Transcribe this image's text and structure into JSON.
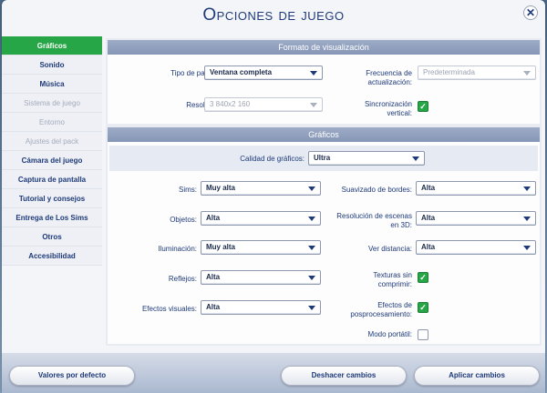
{
  "title": "Opciones de juego",
  "close_glyph": "✕",
  "sidebar": {
    "items": [
      {
        "label": "Gráficos",
        "state": "active"
      },
      {
        "label": "Sonido",
        "state": "normal"
      },
      {
        "label": "Música",
        "state": "normal"
      },
      {
        "label": "Sistema de juego",
        "state": "disabled"
      },
      {
        "label": "Entorno",
        "state": "disabled"
      },
      {
        "label": "Ajustes del pack",
        "state": "disabled"
      },
      {
        "label": "Cámara del juego",
        "state": "normal"
      },
      {
        "label": "Captura de pantalla",
        "state": "normal"
      },
      {
        "label": "Tutorial y consejos",
        "state": "normal"
      },
      {
        "label": "Entrega de Los Sims",
        "state": "normal"
      },
      {
        "label": "Otros",
        "state": "normal"
      },
      {
        "label": "Accesibilidad",
        "state": "normal"
      }
    ]
  },
  "display": {
    "header": "Formato de visualización",
    "screen_type_label": "Tipo de pantalla:",
    "screen_type_value": "Ventana completa",
    "resolution_label": "Resolución:",
    "resolution_value": "3 840x2 160",
    "refresh_label_1": "Frecuencia de",
    "refresh_label_2": "actualización:",
    "refresh_value": "Predeterminada",
    "vsync_label_1": "Sincronización",
    "vsync_label_2": "vertical:"
  },
  "graphics": {
    "header": "Gráficos",
    "quality_label": "Calidad de gráficos:",
    "quality_value": "Ultra",
    "sims_label": "Sims:",
    "sims_value": "Muy alta",
    "objects_label": "Objetos:",
    "objects_value": "Alta",
    "lighting_label": "Iluminación:",
    "lighting_value": "Muy alta",
    "reflections_label": "Reflejos:",
    "reflections_value": "Alta",
    "effects_label": "Efectos visuales:",
    "effects_value": "Alta",
    "aa_label": "Suavizado de bordes:",
    "aa_value": "Alta",
    "scene_res_label_1": "Resolución de escenas",
    "scene_res_label_2": "en 3D:",
    "scene_res_value": "Alta",
    "view_dist_label": "Ver distancia:",
    "view_dist_value": "Alta",
    "uncompressed_label_1": "Texturas sin",
    "uncompressed_label_2": "comprimir:",
    "postfx_label_1": "Efectos de",
    "postfx_label_2": "posprocesamiento:",
    "laptop_label": "Modo portátil:",
    "check_glyph": "✓"
  },
  "buttons": {
    "defaults": "Valores por defecto",
    "undo": "Deshacer cambios",
    "apply": "Aplicar cambios"
  },
  "colors": {
    "accent_green": "#26a646",
    "title_blue": "#1e3a78",
    "section_header": "#8f9dbb"
  }
}
